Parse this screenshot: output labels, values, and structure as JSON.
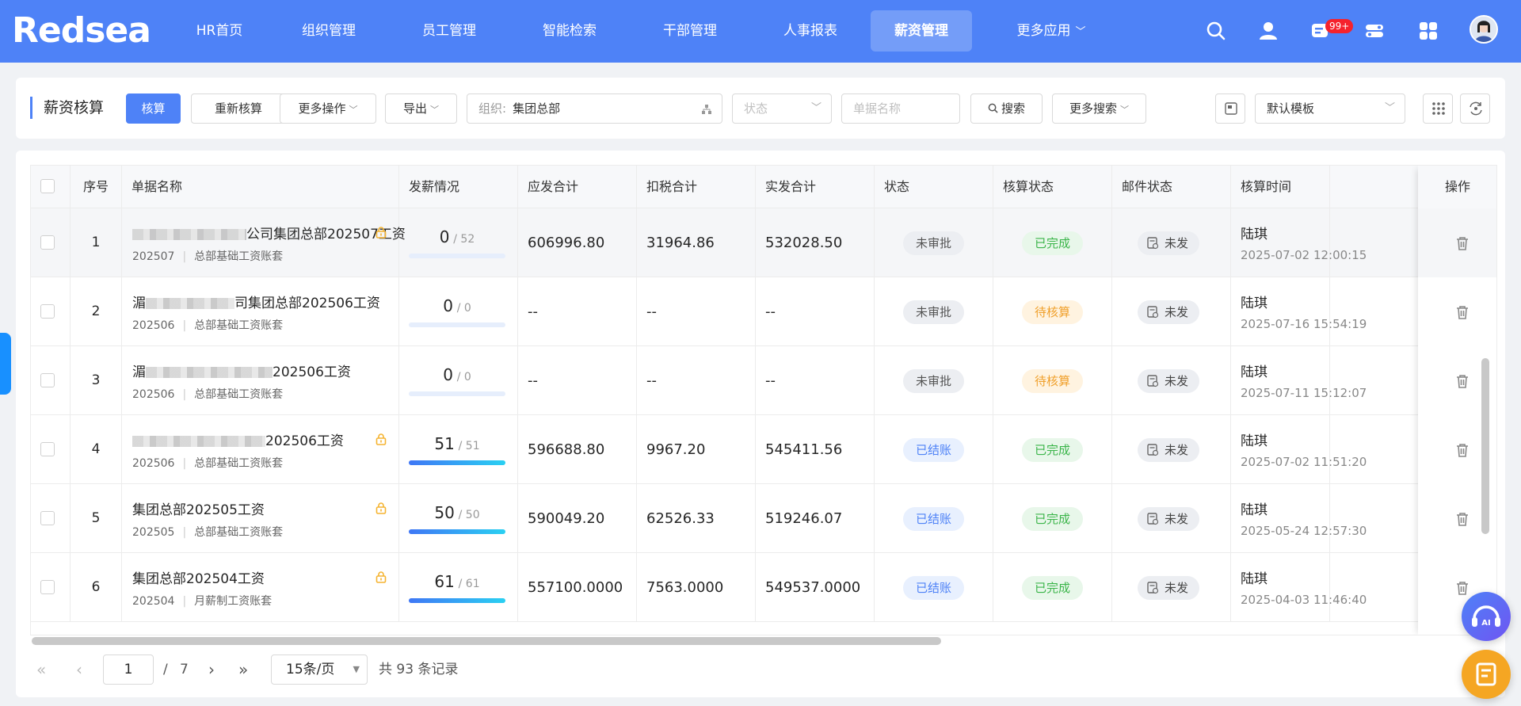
{
  "nav": {
    "logo": "Redsea",
    "items": [
      "HR首页",
      "组织管理",
      "员工管理",
      "智能检索",
      "干部管理",
      "人事报表",
      "薪资管理",
      "更多应用"
    ],
    "active_index": 6,
    "badge": "99+"
  },
  "toolbar": {
    "title": "薪资核算",
    "calc": "核算",
    "recalc": "重新核算",
    "more_ops": "更多操作",
    "export": "导出",
    "org_label": "组织:",
    "org_value": "集团总部",
    "status_placeholder": "状态",
    "name_placeholder": "单据名称",
    "search": "搜索",
    "more_search": "更多搜索",
    "template": "默认模板"
  },
  "table": {
    "columns": [
      "序号",
      "单据名称",
      "发薪情况",
      "应发合计",
      "扣税合计",
      "实发合计",
      "状态",
      "核算状态",
      "邮件状态",
      "核算时间",
      "操作"
    ],
    "rows": [
      {
        "seq": "1",
        "name_prefix": "",
        "name_suffix": "公司集团总部202507工资",
        "period": "202507",
        "book": "总部基础工资账套",
        "locked": true,
        "paid": "0",
        "total": "/ 52",
        "progress": 0,
        "gross": "606996.80",
        "tax": "31964.86",
        "net": "532028.50",
        "status": "未审批",
        "status_color": "gray",
        "calc": "已完成",
        "calc_color": "green",
        "mail": "未发",
        "user": "陆琪",
        "time": "2025-07-02 12:00:15"
      },
      {
        "seq": "2",
        "name_prefix": "湄",
        "name_suffix": "司集团总部202506工资",
        "period": "202506",
        "book": "总部基础工资账套",
        "locked": false,
        "paid": "0",
        "total": "/ 0",
        "progress": 0,
        "gross": "--",
        "tax": "--",
        "net": "--",
        "status": "未审批",
        "status_color": "gray",
        "calc": "待核算",
        "calc_color": "orange",
        "mail": "未发",
        "user": "陆琪",
        "time": "2025-07-16 15:54:19"
      },
      {
        "seq": "3",
        "name_prefix": "湄",
        "name_suffix": "202506工资",
        "period": "202506",
        "book": "总部基础工资账套",
        "locked": false,
        "paid": "0",
        "total": "/ 0",
        "progress": 0,
        "gross": "--",
        "tax": "--",
        "net": "--",
        "status": "未审批",
        "status_color": "gray",
        "calc": "待核算",
        "calc_color": "orange",
        "mail": "未发",
        "user": "陆琪",
        "time": "2025-07-11 15:12:07"
      },
      {
        "seq": "4",
        "name_prefix": "",
        "name_suffix": "202506工资",
        "period": "202506",
        "book": "总部基础工资账套",
        "locked": true,
        "paid": "51",
        "total": "/ 51",
        "progress": 1,
        "gross": "596688.80",
        "tax": "9967.20",
        "net": "545411.56",
        "status": "已结账",
        "status_color": "blue",
        "calc": "已完成",
        "calc_color": "green",
        "mail": "未发",
        "user": "陆琪",
        "time": "2025-07-02 11:51:20"
      },
      {
        "seq": "5",
        "name_prefix": "",
        "name_suffix": "集团总部202505工资",
        "period": "202505",
        "book": "总部基础工资账套",
        "locked": true,
        "paid": "50",
        "total": "/ 50",
        "progress": 1,
        "gross": "590049.20",
        "tax": "62526.33",
        "net": "519246.07",
        "status": "已结账",
        "status_color": "blue",
        "calc": "已完成",
        "calc_color": "green",
        "mail": "未发",
        "user": "陆琪",
        "time": "2025-05-24 12:57:30"
      },
      {
        "seq": "6",
        "name_prefix": "",
        "name_suffix": "集团总部202504工资",
        "period": "202504",
        "book": "月薪制工资账套",
        "locked": true,
        "paid": "61",
        "total": "/ 61",
        "progress": 1,
        "gross": "557100.0000",
        "tax": "7563.0000",
        "net": "549537.0000",
        "status": "已结账",
        "status_color": "blue",
        "calc": "已完成",
        "calc_color": "green",
        "mail": "未发",
        "user": "陆琪",
        "time": "2025-04-03 11:46:40"
      }
    ]
  },
  "pager": {
    "current": "1",
    "slash": "/",
    "pages": "7",
    "page_size": "15条/页",
    "total_text": "共 93 条记录"
  },
  "colors": {
    "primary": "#4e82f7",
    "nav_bg": "#4e82f7"
  }
}
